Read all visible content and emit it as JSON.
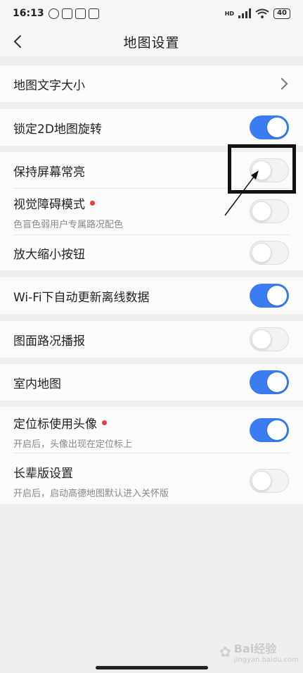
{
  "status_bar": {
    "time": "16:13",
    "battery": "40",
    "network_label": "HD"
  },
  "header": {
    "title": "地图设置"
  },
  "settings": {
    "map_text_size": {
      "label": "地图文字大小"
    },
    "lock_2d_rotation": {
      "label": "锁定2D地图旋转",
      "enabled": true
    },
    "keep_screen_on": {
      "label": "保持屏幕常亮",
      "enabled": false
    },
    "vision_impaired_mode": {
      "label": "视觉障碍模式",
      "desc": "色盲色弱用户专属路况配色",
      "enabled": false,
      "new_dot": true
    },
    "zoom_buttons": {
      "label": "放大缩小按钮",
      "enabled": false
    },
    "wifi_offline_update": {
      "label": "Wi-Fi下自动更新离线数据",
      "enabled": true
    },
    "traffic_broadcast": {
      "label": "图面路况播报",
      "enabled": false
    },
    "indoor_map": {
      "label": "室内地图",
      "enabled": true
    },
    "avatar_location_marker": {
      "label": "定位标使用头像",
      "desc": "开启后，头像出现在定位标上",
      "enabled": true,
      "new_dot": true
    },
    "elder_mode": {
      "label": "长辈版设置",
      "desc": "开启后，启动高德地图默认进入关怀版",
      "enabled": false
    }
  },
  "watermark": {
    "text": "Bai经验",
    "sub": "jingyan.baidu.com"
  },
  "colors": {
    "toggle_on": "#3b7df0",
    "dot": "#ef3b3b",
    "background": "#efeff1"
  }
}
